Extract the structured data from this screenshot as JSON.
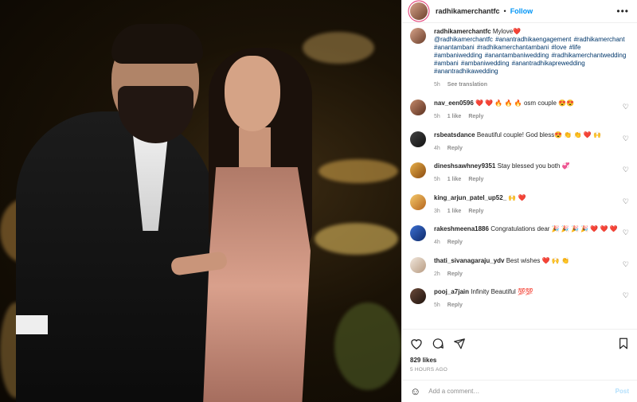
{
  "post": {
    "username": "radhikamerchantfc",
    "follow_label": "Follow",
    "dot": "•",
    "more_label": "•••"
  },
  "caption": {
    "username": "radhikamerchantfc",
    "text": "Mylove❤️",
    "tags": "@radhikamerchantfc #anantradhikaengagement #radhikamerchant #anantambani #radhikamerchantambani #love #life #ambaniwedding #anantambaniwedding #radhikamerchantwedding #ambani #ambaniwedding #anantradhikaprewedding #anantradhikawedding",
    "time": "5h",
    "see_translation": "See translation"
  },
  "comments": [
    {
      "username": "nav_een0596",
      "text": "❤️ ❤️  🔥 🔥 🔥 osm couple 😍😍",
      "time": "5h",
      "likes": "1 like",
      "reply": "Reply"
    },
    {
      "username": "rsbeatsdance",
      "text": "Beautiful couple! God bless😍 👏 👏 ❤️ 🙌",
      "time": "4h",
      "likes": "",
      "reply": "Reply"
    },
    {
      "username": "dineshsawhney9351",
      "text": "Stay blessed you both 💞",
      "time": "5h",
      "likes": "1 like",
      "reply": "Reply"
    },
    {
      "username": "king_arjun_patel_up52_",
      "text": "🙌 ❤️",
      "time": "3h",
      "likes": "1 like",
      "reply": "Reply"
    },
    {
      "username": "rakeshmeena1886",
      "text": "Congratulations dear 🎉 🎉 🎉 🎉 ❤️ ❤️ ❤️",
      "time": "4h",
      "likes": "",
      "reply": "Reply"
    },
    {
      "username": "thati_sivanagaraju_ydv",
      "text": "Best wishes ❤️ 🙌 👏",
      "time": "2h",
      "likes": "",
      "reply": "Reply"
    },
    {
      "username": "pooj_a7jain",
      "text": "Infinity Beautiful 💯💯",
      "time": "5h",
      "likes": "",
      "reply": "Reply"
    }
  ],
  "stats": {
    "likes": "829 likes",
    "posted": "5 HOURS AGO"
  },
  "composer": {
    "placeholder": "Add a comment…",
    "post_label": "Post"
  },
  "icons": {
    "like": "heart-icon",
    "comment": "comment-icon",
    "share": "share-icon",
    "save": "bookmark-icon",
    "emoji": "emoji-icon"
  },
  "colors": {
    "accent": "#0095f6",
    "tag": "#00376b",
    "muted": "#8e8e8e"
  }
}
